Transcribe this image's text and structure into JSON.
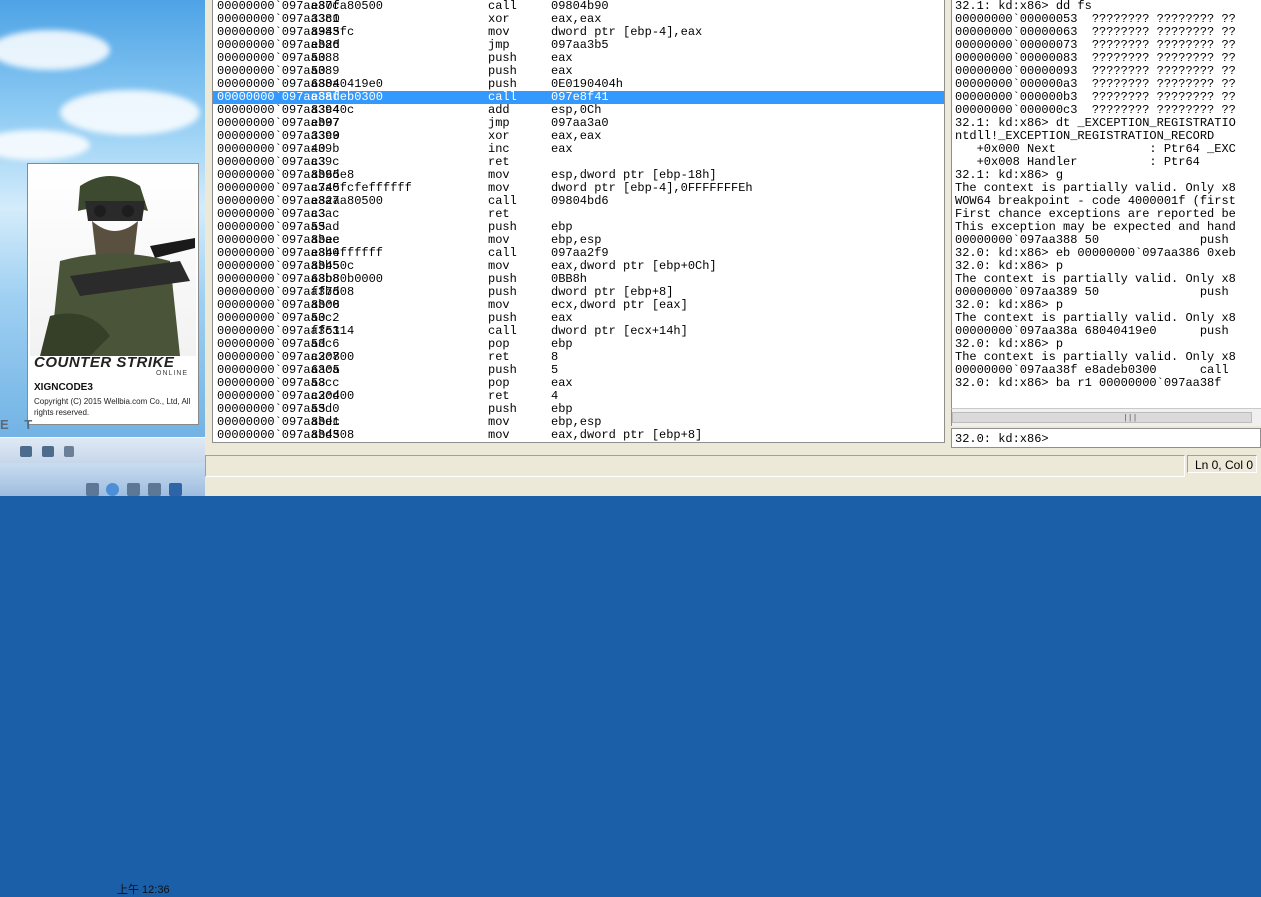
{
  "splash": {
    "logo": "COUNTER STRIKE",
    "logo_sub": "ONLINE",
    "product": "XIGNCODE3",
    "copyright": "Copyright (C) 2015 Wellbia.com Co., Ltd, All rights reserved."
  },
  "desktop": {
    "watermark": "E T",
    "clock": "上午 12:36"
  },
  "disassembly": [
    {
      "addr": "00000000`097aa37c",
      "bytes": "e80fa80500",
      "mn": "call",
      "op": "09804b90"
    },
    {
      "addr": "00000000`097aa381",
      "bytes": "33c0",
      "mn": "xor",
      "op": "eax,eax"
    },
    {
      "addr": "00000000`097aa383",
      "bytes": "8945fc",
      "mn": "mov",
      "op": "dword ptr [ebp-4],eax"
    },
    {
      "addr": "00000000`097aa386",
      "bytes": "eb2d",
      "mn": "jmp",
      "op": "097aa3b5"
    },
    {
      "addr": "00000000`097aa388",
      "bytes": "50",
      "mn": "push",
      "op": "eax"
    },
    {
      "addr": "00000000`097aa389",
      "bytes": "50",
      "mn": "push",
      "op": "eax"
    },
    {
      "addr": "00000000`097aa38a",
      "bytes": "68040419e0",
      "mn": "push",
      "op": "0E0190404h"
    },
    {
      "addr": "00000000`097aa38f",
      "bytes": "e8adeb0300",
      "mn": "call",
      "op": "097e8f41",
      "selected": true
    },
    {
      "addr": "00000000`097aa394",
      "bytes": "83c40c",
      "mn": "add",
      "op": "esp,0Ch"
    },
    {
      "addr": "00000000`097aa397",
      "bytes": "eb07",
      "mn": "jmp",
      "op": "097aa3a0"
    },
    {
      "addr": "00000000`097aa399",
      "bytes": "33c0",
      "mn": "xor",
      "op": "eax,eax"
    },
    {
      "addr": "00000000`097aa39b",
      "bytes": "40",
      "mn": "inc",
      "op": "eax"
    },
    {
      "addr": "00000000`097aa39c",
      "bytes": "c3",
      "mn": "ret",
      "op": ""
    },
    {
      "addr": "00000000`097aa39d",
      "bytes": "8b65e8",
      "mn": "mov",
      "op": "esp,dword ptr [ebp-18h]"
    },
    {
      "addr": "00000000`097aa3a0",
      "bytes": "c745fcfeffffff",
      "mn": "mov",
      "op": "dword ptr [ebp-4],0FFFFFFFEh"
    },
    {
      "addr": "00000000`097aa3a7",
      "bytes": "e82aa80500",
      "mn": "call",
      "op": "09804bd6"
    },
    {
      "addr": "00000000`097aa3ac",
      "bytes": "c3",
      "mn": "ret",
      "op": ""
    },
    {
      "addr": "00000000`097aa3ad",
      "bytes": "55",
      "mn": "push",
      "op": "ebp"
    },
    {
      "addr": "00000000`097aa3ae",
      "bytes": "8bec",
      "mn": "mov",
      "op": "ebp,esp"
    },
    {
      "addr": "00000000`097aa3b0",
      "bytes": "e844ffffff",
      "mn": "call",
      "op": "097aa2f9"
    },
    {
      "addr": "00000000`097aa3b5",
      "bytes": "8b450c",
      "mn": "mov",
      "op": "eax,dword ptr [ebp+0Ch]"
    },
    {
      "addr": "00000000`097aa3b8",
      "bytes": "68b80b0000",
      "mn": "push",
      "op": "0BB8h"
    },
    {
      "addr": "00000000`097aa3bd",
      "bytes": "ff7508",
      "mn": "push",
      "op": "dword ptr [ebp+8]"
    },
    {
      "addr": "00000000`097aa3c0",
      "bytes": "8b08",
      "mn": "mov",
      "op": "ecx,dword ptr [eax]"
    },
    {
      "addr": "00000000`097aa3c2",
      "bytes": "50",
      "mn": "push",
      "op": "eax"
    },
    {
      "addr": "00000000`097aa3c3",
      "bytes": "ff5114",
      "mn": "call",
      "op": "dword ptr [ecx+14h]"
    },
    {
      "addr": "00000000`097aa3c6",
      "bytes": "5d",
      "mn": "pop",
      "op": "ebp"
    },
    {
      "addr": "00000000`097aa3c7",
      "bytes": "c20800",
      "mn": "ret",
      "op": "8"
    },
    {
      "addr": "00000000`097aa3ca",
      "bytes": "6a05",
      "mn": "push",
      "op": "5"
    },
    {
      "addr": "00000000`097aa3cc",
      "bytes": "58",
      "mn": "pop",
      "op": "eax"
    },
    {
      "addr": "00000000`097aa3cd",
      "bytes": "c20400",
      "mn": "ret",
      "op": "4"
    },
    {
      "addr": "00000000`097aa3d0",
      "bytes": "55",
      "mn": "push",
      "op": "ebp"
    },
    {
      "addr": "00000000`097aa3d1",
      "bytes": "8bec",
      "mn": "mov",
      "op": "ebp,esp"
    },
    {
      "addr": "00000000`097aa3d3",
      "bytes": "8b4508",
      "mn": "mov",
      "op": "eax,dword ptr [ebp+8]"
    }
  ],
  "command_output": [
    "32.1: kd:x86> dd fs",
    "00000000`00000053  ???????? ???????? ??",
    "00000000`00000063  ???????? ???????? ??",
    "00000000`00000073  ???????? ???????? ??",
    "00000000`00000083  ???????? ???????? ??",
    "00000000`00000093  ???????? ???????? ??",
    "00000000`000000a3  ???????? ???????? ??",
    "00000000`000000b3  ???????? ???????? ??",
    "00000000`000000c3  ???????? ???????? ??",
    "32.1: kd:x86> dt _EXCEPTION_REGISTRATIO",
    "ntdll!_EXCEPTION_REGISTRATION_RECORD",
    "   +0x000 Next             : Ptr64 _EXC",
    "   +0x008 Handler          : Ptr64",
    "32.1: kd:x86> g",
    "The context is partially valid. Only x8",
    "WOW64 breakpoint - code 4000001f (first",
    "First chance exceptions are reported be",
    "This exception may be expected and hand",
    "00000000`097aa388 50              push",
    "32.0: kd:x86> eb 00000000`097aa386 0xeb",
    "32.0: kd:x86> p",
    "The context is partially valid. Only x8",
    "00000000`097aa389 50              push",
    "32.0: kd:x86> p",
    "The context is partially valid. Only x8",
    "00000000`097aa38a 68040419e0      push",
    "32.0: kd:x86> p",
    "The context is partially valid. Only x8",
    "00000000`097aa38f e8adeb0300      call",
    "32.0: kd:x86> ba r1 00000000`097aa38f"
  ],
  "command": {
    "prompt": "32.0: kd:x86>",
    "value": ""
  },
  "status": {
    "position": "Ln 0, Col 0"
  }
}
